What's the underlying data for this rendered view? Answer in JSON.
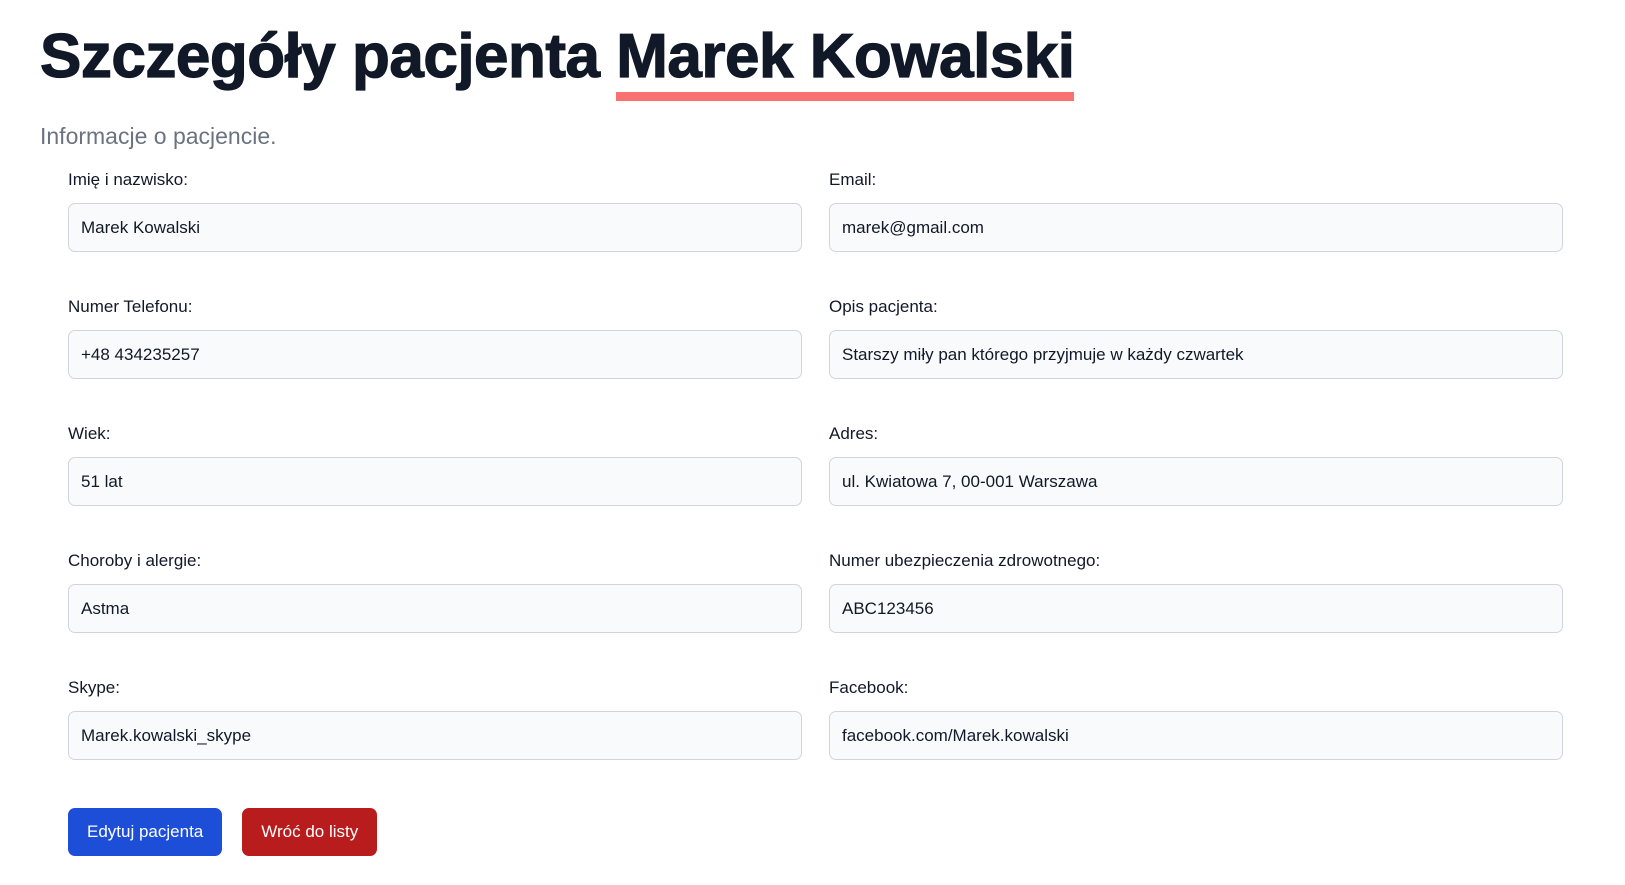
{
  "header": {
    "title_prefix": "Szczegóły pacjenta ",
    "patient_name": "Marek Kowalski",
    "subtitle": "Informacje o pacjencie."
  },
  "fields": {
    "full_name": {
      "label": "Imię i nazwisko:",
      "value": "Marek Kowalski"
    },
    "email": {
      "label": "Email:",
      "value": "marek@gmail.com"
    },
    "phone": {
      "label": "Numer Telefonu:",
      "value": "+48 434235257"
    },
    "description": {
      "label": "Opis pacjenta:",
      "value": "Starszy miły pan którego przyjmuje w każdy czwartek"
    },
    "age": {
      "label": "Wiek:",
      "value": "51 lat"
    },
    "address": {
      "label": "Adres:",
      "value": "ul. Kwiatowa 7, 00-001 Warszawa"
    },
    "conditions": {
      "label": "Choroby i alergie:",
      "value": "Astma"
    },
    "insurance": {
      "label": "Numer ubezpieczenia zdrowotnego:",
      "value": "ABC123456"
    },
    "skype": {
      "label": "Skype:",
      "value": "Marek.kowalski_skype"
    },
    "facebook": {
      "label": "Facebook:",
      "value": "facebook.com/Marek.kowalski"
    }
  },
  "actions": {
    "edit_label": "Edytuj pacjenta",
    "back_label": "Wróć do listy",
    "edit_color": "#1d4ed8",
    "back_color": "#b91c1c"
  },
  "colors": {
    "name_underline": "#f87171",
    "title": "#111827",
    "subtitle": "#6b7280"
  }
}
